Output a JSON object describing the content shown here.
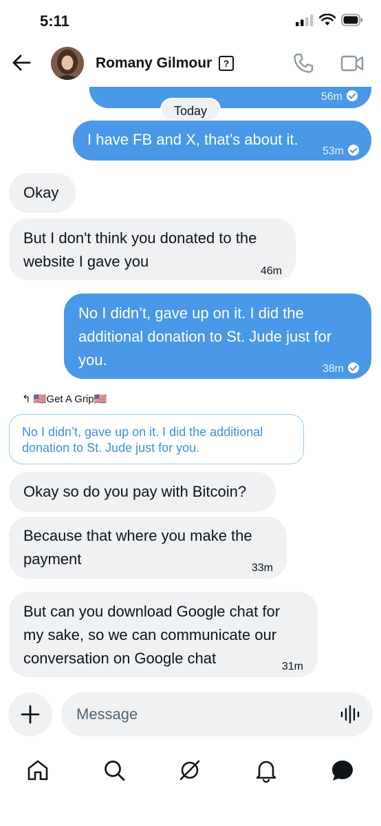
{
  "status_bar": {
    "time": "5:11"
  },
  "header": {
    "contact_name": "Romany Gilmour",
    "badge": "?"
  },
  "messages": {
    "top_partial": {
      "time": "56m"
    },
    "day_separator": "Today",
    "m1": {
      "text": "I have FB and X, that’s about it.",
      "time": "53m"
    },
    "m2": {
      "text": "Okay"
    },
    "m3": {
      "line1": "But I don't think you donated to the",
      "line2": "website I gave you",
      "time": "46m"
    },
    "m4": {
      "line1": "No I didn’t, gave up on it.  I did the",
      "line2": "additional donation to St. Jude just for",
      "line3": "you.",
      "time": "38m"
    },
    "reply_label": "↰ 🇺🇸Get A Grip🇺🇸",
    "quote": {
      "line1": "No I didn’t, gave up on it.  I did the additional",
      "line2": "donation to St. Jude just for you."
    },
    "m5": {
      "text": "Okay so do you pay with Bitcoin?"
    },
    "m6": {
      "line1": "Because that where you make the",
      "line2": "payment",
      "time": "33m"
    },
    "m7": {
      "line1": "But can you download Google chat for",
      "line2": "my sake, so we can communicate our",
      "line3": "conversation on Google chat",
      "time": "31m"
    }
  },
  "composer": {
    "placeholder": "Message"
  },
  "icons": {
    "back": "arrow-left",
    "call": "phone",
    "video": "video-camera",
    "add": "plus",
    "voice": "waveform",
    "home": "home",
    "search": "search",
    "grok": "slash-circle",
    "notifications": "bell",
    "messages": "message-bubble"
  },
  "colors": {
    "sent_bubble": "#4a98e8",
    "received_bubble": "#eff1f3",
    "quote_text": "#3d8fdf"
  }
}
